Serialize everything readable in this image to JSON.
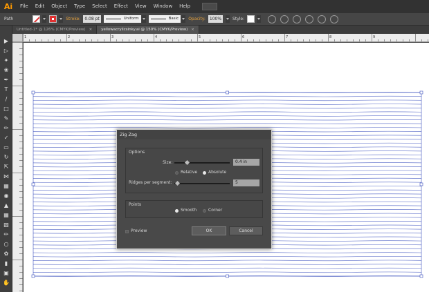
{
  "app": {
    "logo": "Ai"
  },
  "menu": [
    "File",
    "Edit",
    "Object",
    "Type",
    "Select",
    "Effect",
    "View",
    "Window",
    "Help"
  ],
  "control_bar": {
    "selection_label": "Path",
    "stroke_label": "Stroke:",
    "stroke_weight": "0.08 pt",
    "profile": "Uniform",
    "brush": "Basic",
    "opacity_label": "Opacity:",
    "opacity_value": "100%",
    "style_label": "Style:"
  },
  "tabs": [
    {
      "label": "Untitled-1* @ 126% (CMYK/Preview)",
      "active": false
    },
    {
      "label": "yellowacrylicsinky.ai @ 150% (CMYK/Preview)",
      "active": true
    }
  ],
  "ruler_marks": [
    "1",
    "2",
    "3",
    "4",
    "5",
    "6",
    "7",
    "8",
    "9"
  ],
  "canvas": {
    "line_color": "#3a4fbd",
    "line_count": 48
  },
  "dialog": {
    "title": "Zig Zag",
    "options_group": "Options",
    "size_label": "Size:",
    "size_value": "0.4 in",
    "size_fraction": 0.22,
    "relative_label": "Relative",
    "absolute_label": "Absolute",
    "ridges_label": "Ridges per segment:",
    "ridges_value": "5",
    "ridges_fraction": 0.05,
    "points_group": "Points",
    "smooth_label": "Smooth",
    "corner_label": "Corner",
    "preview_label": "Preview",
    "ok_label": "OK",
    "cancel_label": "Cancel"
  },
  "colors": {
    "accent": "#ff9a00",
    "stroke_red": "#e03131",
    "lines_blue": "#3a4fbd"
  }
}
